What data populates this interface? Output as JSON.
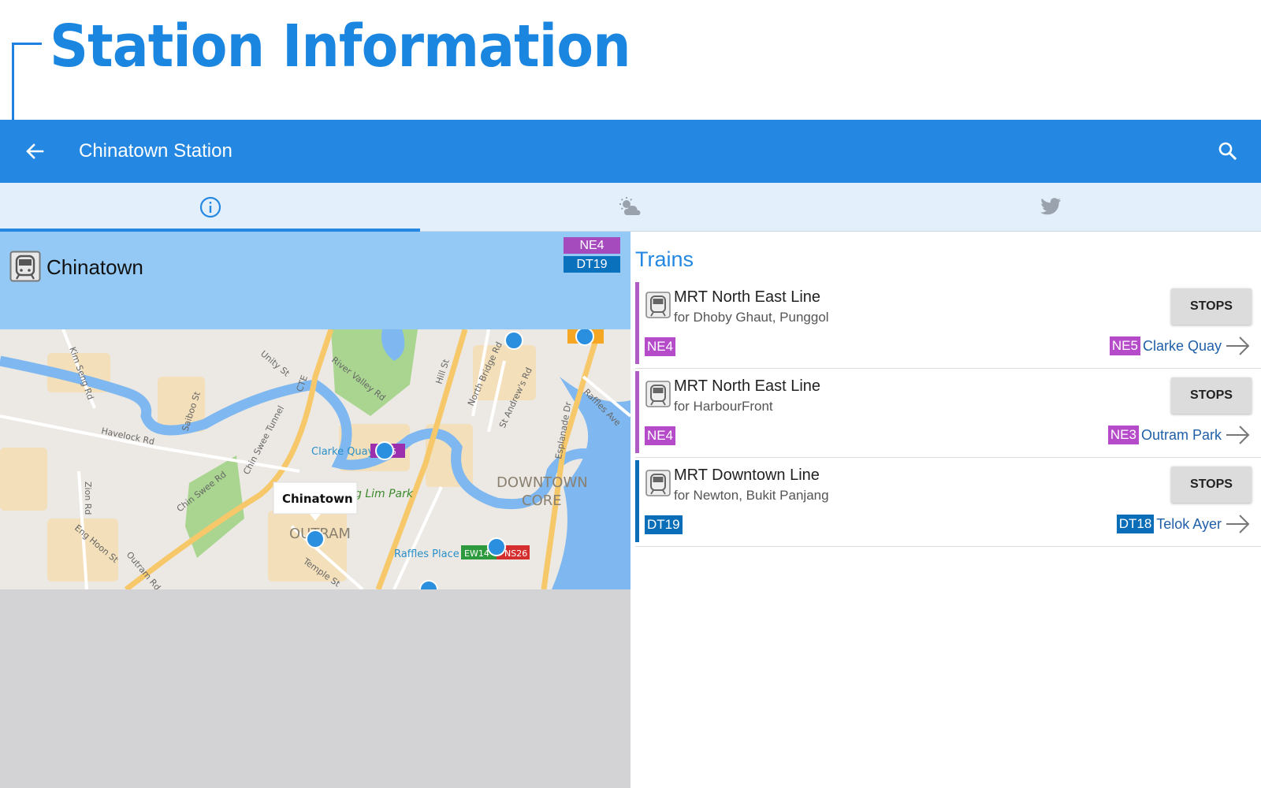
{
  "promo": {
    "title": "Station Information"
  },
  "appbar": {
    "title": "Chinatown Station",
    "back_icon": "arrow-left-icon",
    "search_icon": "search-icon"
  },
  "tabs": [
    {
      "icon": "info-icon",
      "active": true
    },
    {
      "icon": "weather-icon",
      "active": false
    },
    {
      "icon": "twitter-icon",
      "active": false
    }
  ],
  "station": {
    "name": "Chinatown",
    "codes": [
      {
        "code": "NE4",
        "color": "#9b2fae"
      },
      {
        "code": "DT19",
        "color": "#0061a8"
      }
    ]
  },
  "map": {
    "callout": "Chinatown",
    "labels": {
      "downtown_core": "DOWNTOWN\nCORE",
      "outram": "OUTRAM",
      "clarke_quay": "Clarke Quay",
      "raffles_place": "Raffles Place",
      "lim_park": "g Lim Park",
      "kim_seng": "Kim Seng Rd",
      "havelock": "Havelock Rd",
      "zion": "Zion Rd",
      "eng_hoon": "Eng Hoon St",
      "outram_rd": "Outram Rd",
      "chin_swee_rd": "Chin Swee Rd",
      "chin_swee_tunnel": "Chin Swee Tunnel",
      "unity": "Unity St",
      "cte": "CTE",
      "river_valley": "River Valley Rd",
      "hill_st": "Hill St",
      "north_bridge": "North Bridge Rd",
      "st_andrews": "St Andrew's Rd",
      "esplanade": "Esplanade Dr",
      "raffles_ave": "Raffles Ave",
      "saiboo": "Saiboo St",
      "temple": "Temple St",
      "ew14": "EW14",
      "ns26": "NS26",
      "ne5_partial": "5"
    }
  },
  "trains": {
    "title": "Trains",
    "rows": [
      {
        "line": "MRT North East Line",
        "direction": "for Dhoby Ghaut, Punggol",
        "code": "NE4",
        "color": "#9b2fae",
        "stops_label": "STOPS",
        "next_code": "NE5",
        "next_name": "Clarke Quay"
      },
      {
        "line": "MRT North East Line",
        "direction": "for HarbourFront",
        "code": "NE4",
        "color": "#9b2fae",
        "stops_label": "STOPS",
        "next_code": "NE3",
        "next_name": "Outram Park"
      },
      {
        "line": "MRT Downtown Line",
        "direction": "for Newton, Bukit Panjang",
        "code": "DT19",
        "color": "#0061a8",
        "stops_label": "STOPS",
        "next_code": "DT18",
        "next_name": "Telok Ayer"
      }
    ]
  },
  "colors": {
    "accent": "#2488e3",
    "ne_line": "#9b2fae",
    "dt_line": "#0061a8",
    "header_tint": "#94c9f5"
  }
}
